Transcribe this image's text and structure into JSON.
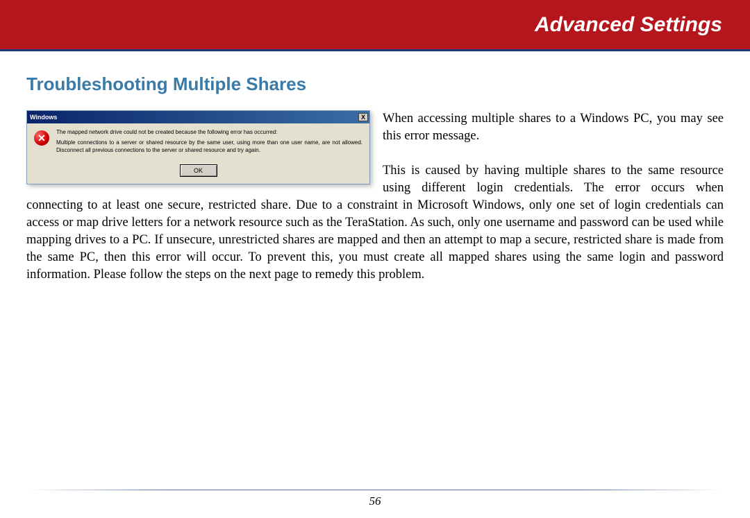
{
  "header": {
    "title": "Advanced Settings"
  },
  "section": {
    "title": "Troubleshooting Multiple Shares"
  },
  "dialog": {
    "title": "Windows",
    "close_label": "X",
    "error_glyph": "✕",
    "line1": "The mapped network drive could not be created because the following error has occurred:",
    "line2": "Multiple connections to a server or shared resource by the same user, using more than one user name, are not allowed. Disconnect all previous connections to the server or shared resource and try again.",
    "ok_label": "OK"
  },
  "body": {
    "para1_a": "When accessing multiple shares to a Windows PC, you may see this error message.",
    "para2_full": "This is caused by having multiple shares to the same resource using different login credentials. The error occurs when connecting to at least one secure, restricted share.  Due to a constraint in Microsoft Windows, only one set of login credentials can access or map drive letters for a network resource such as the TeraStation.  As such, only one username and password can be used while mapping drives to a PC.  If unsecure, unrestricted shares are mapped and then an attempt to map a secure, restricted share is made from the same PC, then this error will occur.  To prevent this, you must create all mapped shares using the same login and password information.  Please follow the steps on the next page to remedy this problem."
  },
  "footer": {
    "page_number": "56"
  }
}
